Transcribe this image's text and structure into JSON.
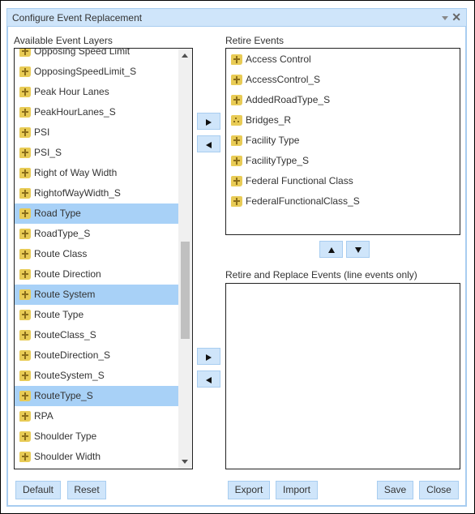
{
  "dialog": {
    "title": "Configure Event Replacement",
    "menu_icon": "dropdown-caret-icon",
    "close_icon": "close-icon"
  },
  "available": {
    "label": "Available Event Layers",
    "items": [
      {
        "label": "Opposing Speed Limit",
        "icon": "line-layer-icon",
        "selected": false
      },
      {
        "label": "OpposingSpeedLimit_S",
        "icon": "line-layer-icon",
        "selected": false
      },
      {
        "label": "Peak Hour Lanes",
        "icon": "line-layer-icon",
        "selected": false
      },
      {
        "label": "PeakHourLanes_S",
        "icon": "line-layer-icon",
        "selected": false
      },
      {
        "label": "PSI",
        "icon": "line-layer-icon",
        "selected": false
      },
      {
        "label": "PSI_S",
        "icon": "line-layer-icon",
        "selected": false
      },
      {
        "label": "Right of Way Width",
        "icon": "line-layer-icon",
        "selected": false
      },
      {
        "label": "RightofWayWidth_S",
        "icon": "line-layer-icon",
        "selected": false
      },
      {
        "label": "Road Type",
        "icon": "line-layer-icon",
        "selected": true
      },
      {
        "label": "RoadType_S",
        "icon": "line-layer-icon",
        "selected": false
      },
      {
        "label": "Route Class",
        "icon": "line-layer-icon",
        "selected": false
      },
      {
        "label": "Route Direction",
        "icon": "line-layer-icon",
        "selected": false
      },
      {
        "label": "Route System",
        "icon": "line-layer-icon",
        "selected": true
      },
      {
        "label": "Route Type",
        "icon": "line-layer-icon",
        "selected": false
      },
      {
        "label": "RouteClass_S",
        "icon": "line-layer-icon",
        "selected": false
      },
      {
        "label": "RouteDirection_S",
        "icon": "line-layer-icon",
        "selected": false
      },
      {
        "label": "RouteSystem_S",
        "icon": "line-layer-icon",
        "selected": false
      },
      {
        "label": "RouteType_S",
        "icon": "line-layer-icon",
        "selected": true
      },
      {
        "label": "RPA",
        "icon": "line-layer-icon",
        "selected": false
      },
      {
        "label": "Shoulder Type",
        "icon": "line-layer-icon",
        "selected": false
      },
      {
        "label": "Shoulder Width",
        "icon": "line-layer-icon",
        "selected": false
      }
    ]
  },
  "retire": {
    "label": "Retire Events",
    "items": [
      {
        "label": "Access Control",
        "icon": "line-layer-icon"
      },
      {
        "label": "AccessControl_S",
        "icon": "line-layer-icon"
      },
      {
        "label": "AddedRoadType_S",
        "icon": "line-layer-icon"
      },
      {
        "label": "Bridges_R",
        "icon": "point-layer-icon"
      },
      {
        "label": "Facility Type",
        "icon": "line-layer-icon"
      },
      {
        "label": "FacilityType_S",
        "icon": "line-layer-icon"
      },
      {
        "label": "Federal Functional Class",
        "icon": "line-layer-icon"
      },
      {
        "label": "FederalFunctionalClass_S",
        "icon": "line-layer-icon"
      }
    ]
  },
  "replace": {
    "label": "Retire and Replace Events (line events only)",
    "items": []
  },
  "buttons": {
    "default": "Default",
    "reset": "Reset",
    "export": "Export",
    "import": "Import",
    "save": "Save",
    "close": "Close"
  },
  "colors": {
    "accent": "#cfe5fa",
    "accent_border": "#a8cdf0",
    "selection": "#a8d1f7",
    "layer_icon": "#e8cb56"
  }
}
